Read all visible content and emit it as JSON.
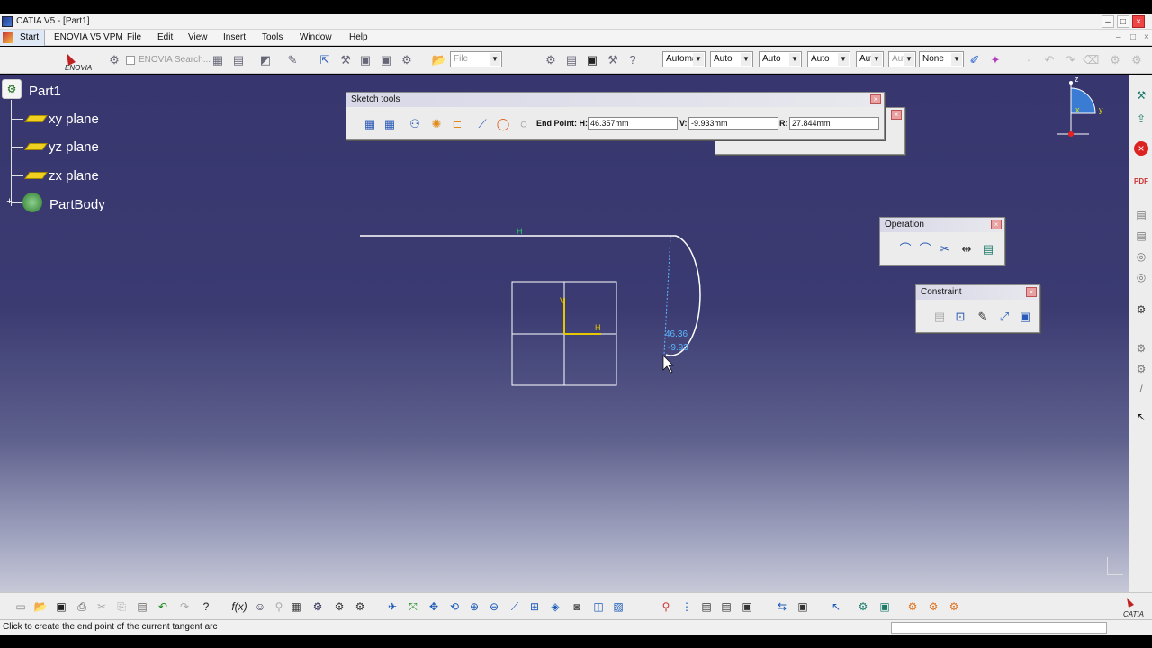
{
  "window": {
    "title": "CATIA V5 - [Part1]",
    "controls": [
      "–",
      "□",
      "×"
    ]
  },
  "menu": {
    "start": "Start",
    "items": [
      "ENOVIA V5 VPM",
      "File",
      "Edit",
      "View",
      "Insert",
      "Tools",
      "Window",
      "Help"
    ]
  },
  "toolbar": {
    "enovia_logo": "ENOVIA",
    "enovia_search": "ENOVIA Search...",
    "file_combo": "File",
    "combos": [
      "Automa",
      "Auto",
      "Auto",
      "Auto",
      "Aut",
      "Aut",
      "None"
    ]
  },
  "tree": {
    "root": "Part1",
    "planes": [
      "xy plane",
      "yz plane",
      "zx plane"
    ],
    "body": "PartBody"
  },
  "sketch_tools": {
    "title": "Sketch tools",
    "end_point_label": "End Point: H:",
    "h_value": "46.357mm",
    "v_label": "V:",
    "v_value": "-9.933mm",
    "r_label": "R:",
    "r_value": "27.844mm"
  },
  "operation": {
    "title": "Operation"
  },
  "constraint": {
    "title": "Constraint"
  },
  "canvas": {
    "constraint_h": "H",
    "axis_v": "V",
    "axis_h": "H",
    "cursor_h": "46.36",
    "cursor_v": "-9.93"
  },
  "compass": {
    "x": "x",
    "y": "y",
    "z": "z"
  },
  "status": {
    "message": "Click to create the end point of the current tangent arc"
  },
  "colors": {
    "viewport_top": "#37366e",
    "sketch_line": "#ffffff",
    "axis_yellow": "#e6c800",
    "dim_text": "#59b7ff"
  },
  "catia_logo": "CATIA"
}
